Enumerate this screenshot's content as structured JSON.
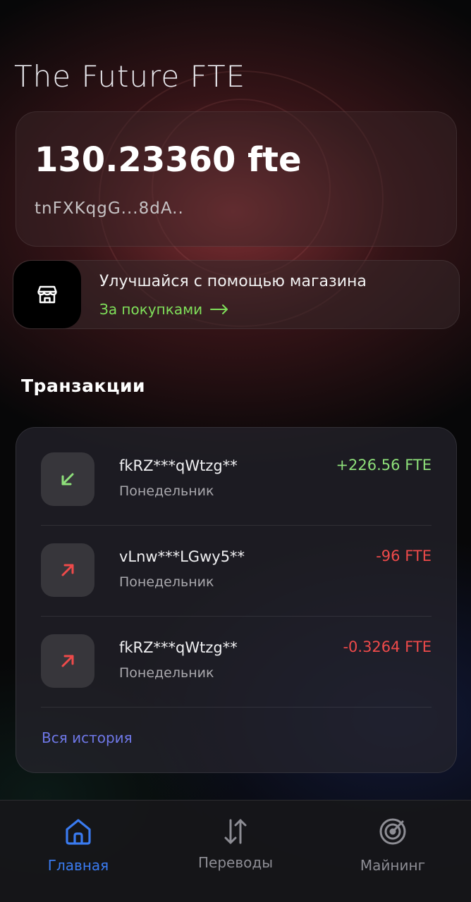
{
  "app": {
    "title": "The Future FTE"
  },
  "balance": {
    "amount": "130.23360 fte",
    "address": "tnFXKqgG...8dA.."
  },
  "shop_banner": {
    "title": "Улучшайся с помощью магазина",
    "link_label": "За покупками",
    "icon": "store-icon",
    "link_color": "#7fe05a"
  },
  "transactions": {
    "title": "Транзакции",
    "items": [
      {
        "name": "fkRZ***qWtzg**",
        "date": "Понедельник",
        "amount": "+226.56 FTE",
        "direction": "incoming",
        "icon": "arrow-down-left-icon"
      },
      {
        "name": "vLnw***LGwy5**",
        "date": "Понедельник",
        "amount": "-96 FTE",
        "direction": "outgoing",
        "icon": "arrow-up-right-icon"
      },
      {
        "name": "fkRZ***qWtzg**",
        "date": "Понедельник",
        "amount": "-0.3264 FTE",
        "direction": "outgoing",
        "icon": "arrow-up-right-icon"
      }
    ],
    "all_history_label": "Вся история"
  },
  "bottom_nav": {
    "items": [
      {
        "label": "Главная",
        "icon": "home-icon",
        "active": true
      },
      {
        "label": "Переводы",
        "icon": "transfer-arrows-icon",
        "active": false
      },
      {
        "label": "Майнинг",
        "icon": "radar-icon",
        "active": false
      }
    ]
  },
  "colors": {
    "incoming": "#8ee07a",
    "outgoing": "#ee4a4a",
    "accent_blue": "#3a7bf0",
    "link_purple": "#6f78e8"
  }
}
